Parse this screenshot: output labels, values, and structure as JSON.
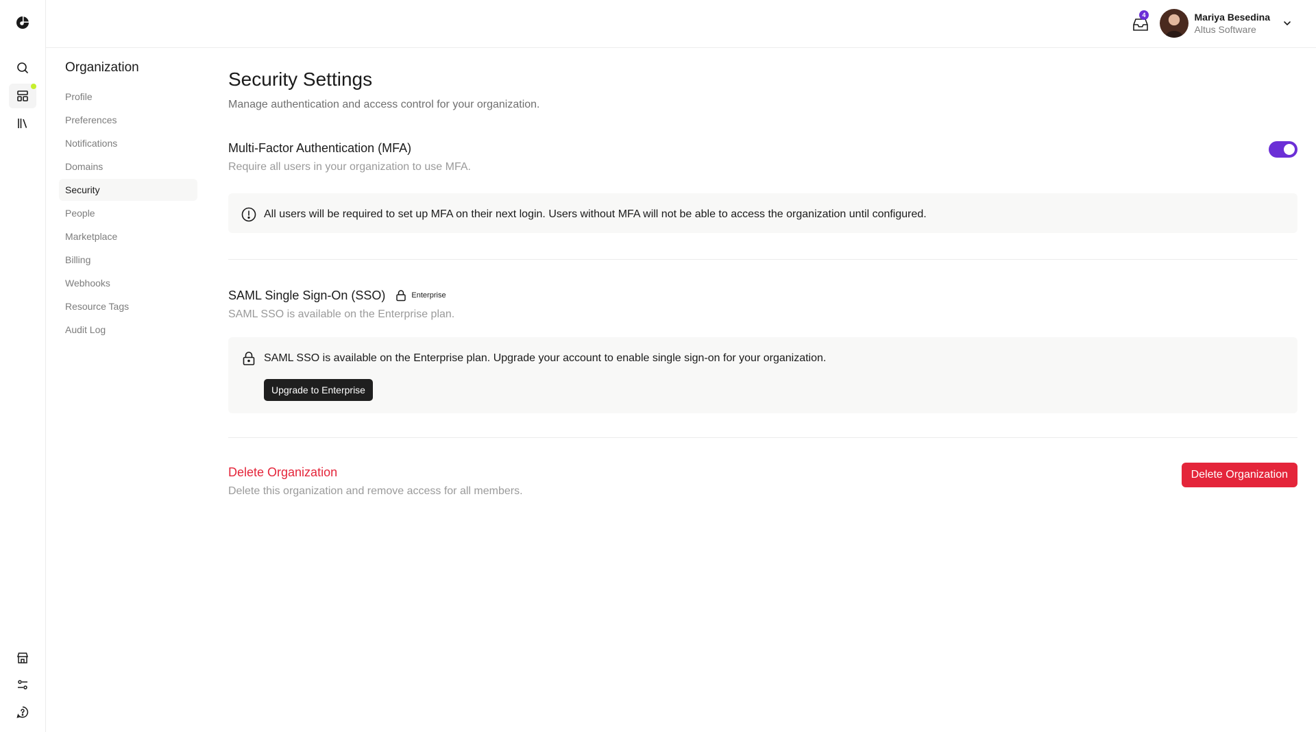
{
  "rail": {
    "icons": [
      "app-logo",
      "search-icon",
      "dashboard-icon",
      "library-icon",
      "store-icon",
      "sliders-icon",
      "help-icon"
    ]
  },
  "header": {
    "notifications_count": "4",
    "user_name": "Mariya Besedina",
    "user_org": "Altus Software"
  },
  "settings_nav": {
    "title": "Organization",
    "items": [
      {
        "label": "Profile"
      },
      {
        "label": "Preferences"
      },
      {
        "label": "Notifications"
      },
      {
        "label": "Domains"
      },
      {
        "label": "Security"
      },
      {
        "label": "People"
      },
      {
        "label": "Marketplace"
      },
      {
        "label": "Billing"
      },
      {
        "label": "Webhooks"
      },
      {
        "label": "Resource Tags"
      },
      {
        "label": "Audit Log"
      }
    ],
    "active": "Security"
  },
  "page": {
    "title": "Security Settings",
    "subtitle": "Manage authentication and access control for your organization."
  },
  "mfa": {
    "title": "Multi-Factor Authentication (MFA)",
    "description": "Require all users in your organization to use MFA.",
    "enabled": true,
    "notice": "All users will be required to set up MFA on their next login. Users without MFA will not be able to access the organization until configured."
  },
  "sso": {
    "title": "SAML Single Sign-On (SSO)",
    "badge": "Enterprise",
    "description": "SAML SSO is available on the Enterprise plan.",
    "notice": "SAML SSO is available on the Enterprise plan. Upgrade your account to enable single sign-on for your organization.",
    "upgrade_label": "Upgrade to Enterprise"
  },
  "danger": {
    "title": "Delete Organization",
    "description": "Delete this organization and remove access for all members.",
    "button_label": "Delete Organization"
  },
  "colors": {
    "accent": "#6b2fd6",
    "danger": "#e4253a",
    "status_dot": "#c6ef2e"
  }
}
